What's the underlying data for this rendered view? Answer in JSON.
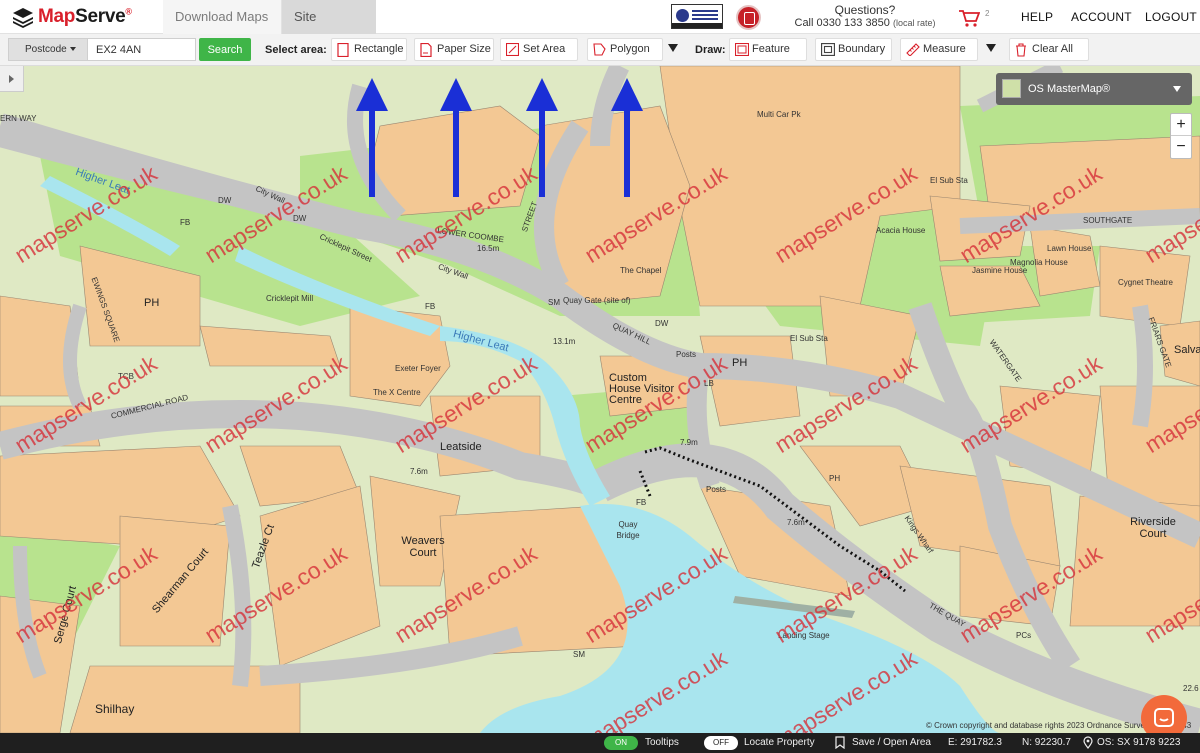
{
  "header": {
    "brand_part1": "Map",
    "brand_part2": "Serve",
    "brand_reg": "®",
    "tabs": [
      {
        "label": "Download Maps",
        "active": false
      },
      {
        "label": "Site Analyser",
        "active": true
      }
    ],
    "questions_label": "Questions?",
    "phone_label": "Call 0330 133 3850",
    "phone_note": "(local rate)",
    "basket_count": "2",
    "links": {
      "help": "HELP",
      "account": "ACCOUNT",
      "logout": "LOGOUT"
    }
  },
  "toolbar": {
    "postcode_dropdown": "Postcode",
    "search_value": "EX2 4AN",
    "search_button": "Search",
    "select_area_label": "Select area:",
    "select_area_buttons": [
      "Rectangle",
      "Paper Size",
      "Set Area",
      "Polygon"
    ],
    "draw_label": "Draw:",
    "draw_buttons": [
      "Feature",
      "Boundary",
      "Measure"
    ],
    "clear_all": "Clear All"
  },
  "map": {
    "layer": "OS MasterMap®",
    "zoom_in": "+",
    "zoom_out": "−",
    "copyright": "© Crown copyright and database rights 2023 Ordnance Survey 100064143",
    "watermark": "mapserve.co.uk",
    "labels": {
      "multi_car_pk": "Multi Car Pk",
      "el_sub_sta_1": "El Sub Sta",
      "southgate": "SOUTHGATE",
      "acacia_house": "Acacia House",
      "lawn_house": "Lawn House",
      "magnolia_house": "Magnolia House",
      "jasmine_house": "Jasmine House",
      "cygnet_theatre": "Cygnet Theatre",
      "friars_gate": "FRIARS GATE",
      "salva": "Salva",
      "higher_leat_1": "Higher Leat",
      "higher_leat_2": "Higher Leat",
      "city_wall_1": "City Wall",
      "city_wall_2": "City Wall",
      "lower_coombe": "LOWER  COOMBE",
      "street": "STREET",
      "cricklepit_street": "Cricklepit Street",
      "cricklepit_mill": "Cricklepit Mill",
      "ewings_square": "EWINGS SQUARE",
      "ph_1": "PH",
      "ph_2": "PH",
      "ph_3": "PH",
      "the_chapel": "The Chapel",
      "quay_gate": "Quay Gate (site of)",
      "quay_hill": "QUAY HILL",
      "custom_house": "Custom House Visitor Centre",
      "el_sub_sta_2": "El Sub Sta",
      "waterbeer": "WATERGATE",
      "exeter_foyer": "Exeter Foyer",
      "the_x_centre": "The X Centre",
      "leatside": "Leatside",
      "commercial_road": "COMMERCIAL  ROAD",
      "tcb": "TCB",
      "weavers_court": "Weavers Court",
      "quay_bridge": "Quay Bridge",
      "shearman_court": "Shearman Court",
      "teazle_ct": "Teazle Ct",
      "serge_court": "Serge Court",
      "kings_wharf": "Kings Wharf",
      "riverside_court": "Riverside Court",
      "landing_stage": "Landing Stage",
      "the_quay": "THE QUAY",
      "shilhay": "Shilhay",
      "posts_1": "Posts",
      "posts_2": "Posts",
      "spot_16": "16.5m",
      "spot_13": "13.1m",
      "spot_7a": "7.6m",
      "spot_7b": "7.9m",
      "spot_7c": "7.6m",
      "dw_1": "DW",
      "dw_2": "DW",
      "dw_3": "DW",
      "fb_1": "FB",
      "fb_2": "FB",
      "fb_3": "FB",
      "sm_1": "SM",
      "sm_2": "SM",
      "lb": "LB",
      "pcs": "PCs",
      "ern_way": "ERN WAY",
      "ref_22": "22.6"
    }
  },
  "statusbar": {
    "tooltips_state": "ON",
    "tooltips_label": "Tooltips",
    "locate_state": "OFF",
    "locate_label": "Locate Property",
    "save_label": "Save / Open Area",
    "easting": "E: 291782.3",
    "northing": "N: 92230.7",
    "os_ref": "OS: SX 9178 9223"
  },
  "colors": {
    "brand_red": "#d9202b",
    "search_green": "#3fb548",
    "annotation_arrow": "#1a2fd6",
    "building": "#f3c894",
    "open_land": "#dfe9c4",
    "green_space": "#b8e38e",
    "road": "#c4c4c4",
    "water": "#a9e5ee",
    "chat": "#f26a3b"
  }
}
